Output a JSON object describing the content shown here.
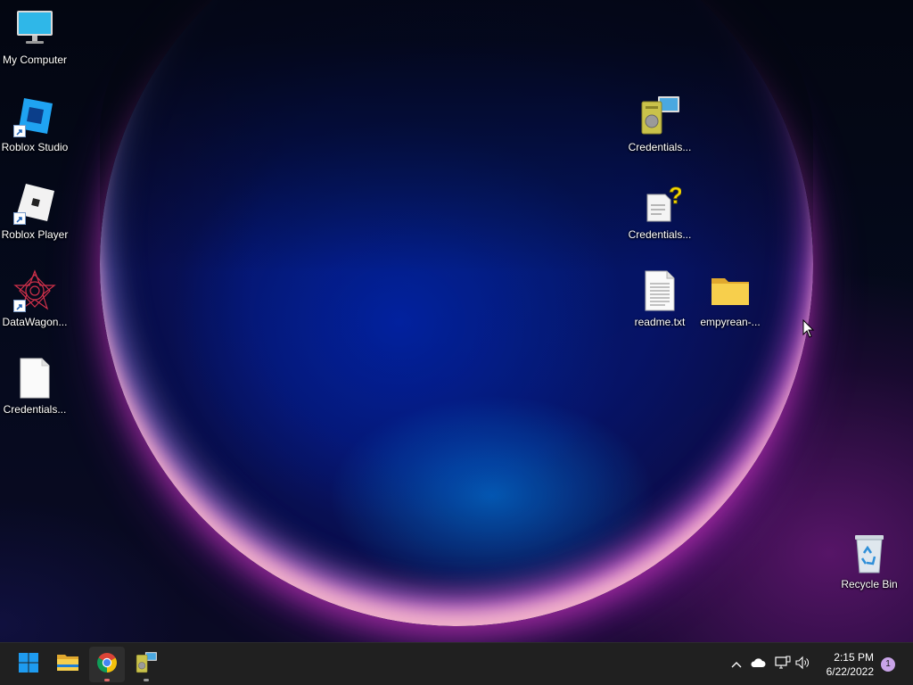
{
  "desktop": {
    "left_icons": [
      {
        "label": "My Computer",
        "icon": "monitor-icon"
      },
      {
        "label": "Roblox Studio",
        "icon": "roblox-studio-icon"
      },
      {
        "label": "Roblox Player",
        "icon": "roblox-player-icon"
      },
      {
        "label": "DataWagon...",
        "icon": "datawagon-icon"
      },
      {
        "label": "Credentials...",
        "icon": "blank-file-icon"
      }
    ],
    "right_icons": [
      {
        "label": "Credentials...",
        "icon": "computer-tower-icon"
      },
      {
        "label": "Credentials...",
        "icon": "unknown-file-icon"
      },
      {
        "label": "readme.txt",
        "icon": "text-file-icon"
      },
      {
        "label": "empyrean-...",
        "icon": "folder-icon"
      },
      {
        "label": "Recycle Bin",
        "icon": "recycle-bin-icon"
      }
    ]
  },
  "taskbar": {
    "apps": [
      {
        "name": "start",
        "icon": "windows-start-icon"
      },
      {
        "name": "file-explorer",
        "icon": "folder-icon"
      },
      {
        "name": "chrome",
        "icon": "chrome-icon",
        "running": true,
        "active": true
      },
      {
        "name": "credentials-app",
        "icon": "computer-tower-icon",
        "running": true
      }
    ],
    "tray": {
      "time": "2:15 PM",
      "date": "6/22/2022",
      "notification_count": "1"
    }
  },
  "colors": {
    "taskbar_bg": "#202020",
    "start_blue": "#1e9bf0",
    "running_indicator_red": "#e06a6a",
    "running_indicator_gray": "#9a9a9a",
    "folder_yellow": "#f4c542",
    "notification_badge": "#c9a4e8"
  }
}
